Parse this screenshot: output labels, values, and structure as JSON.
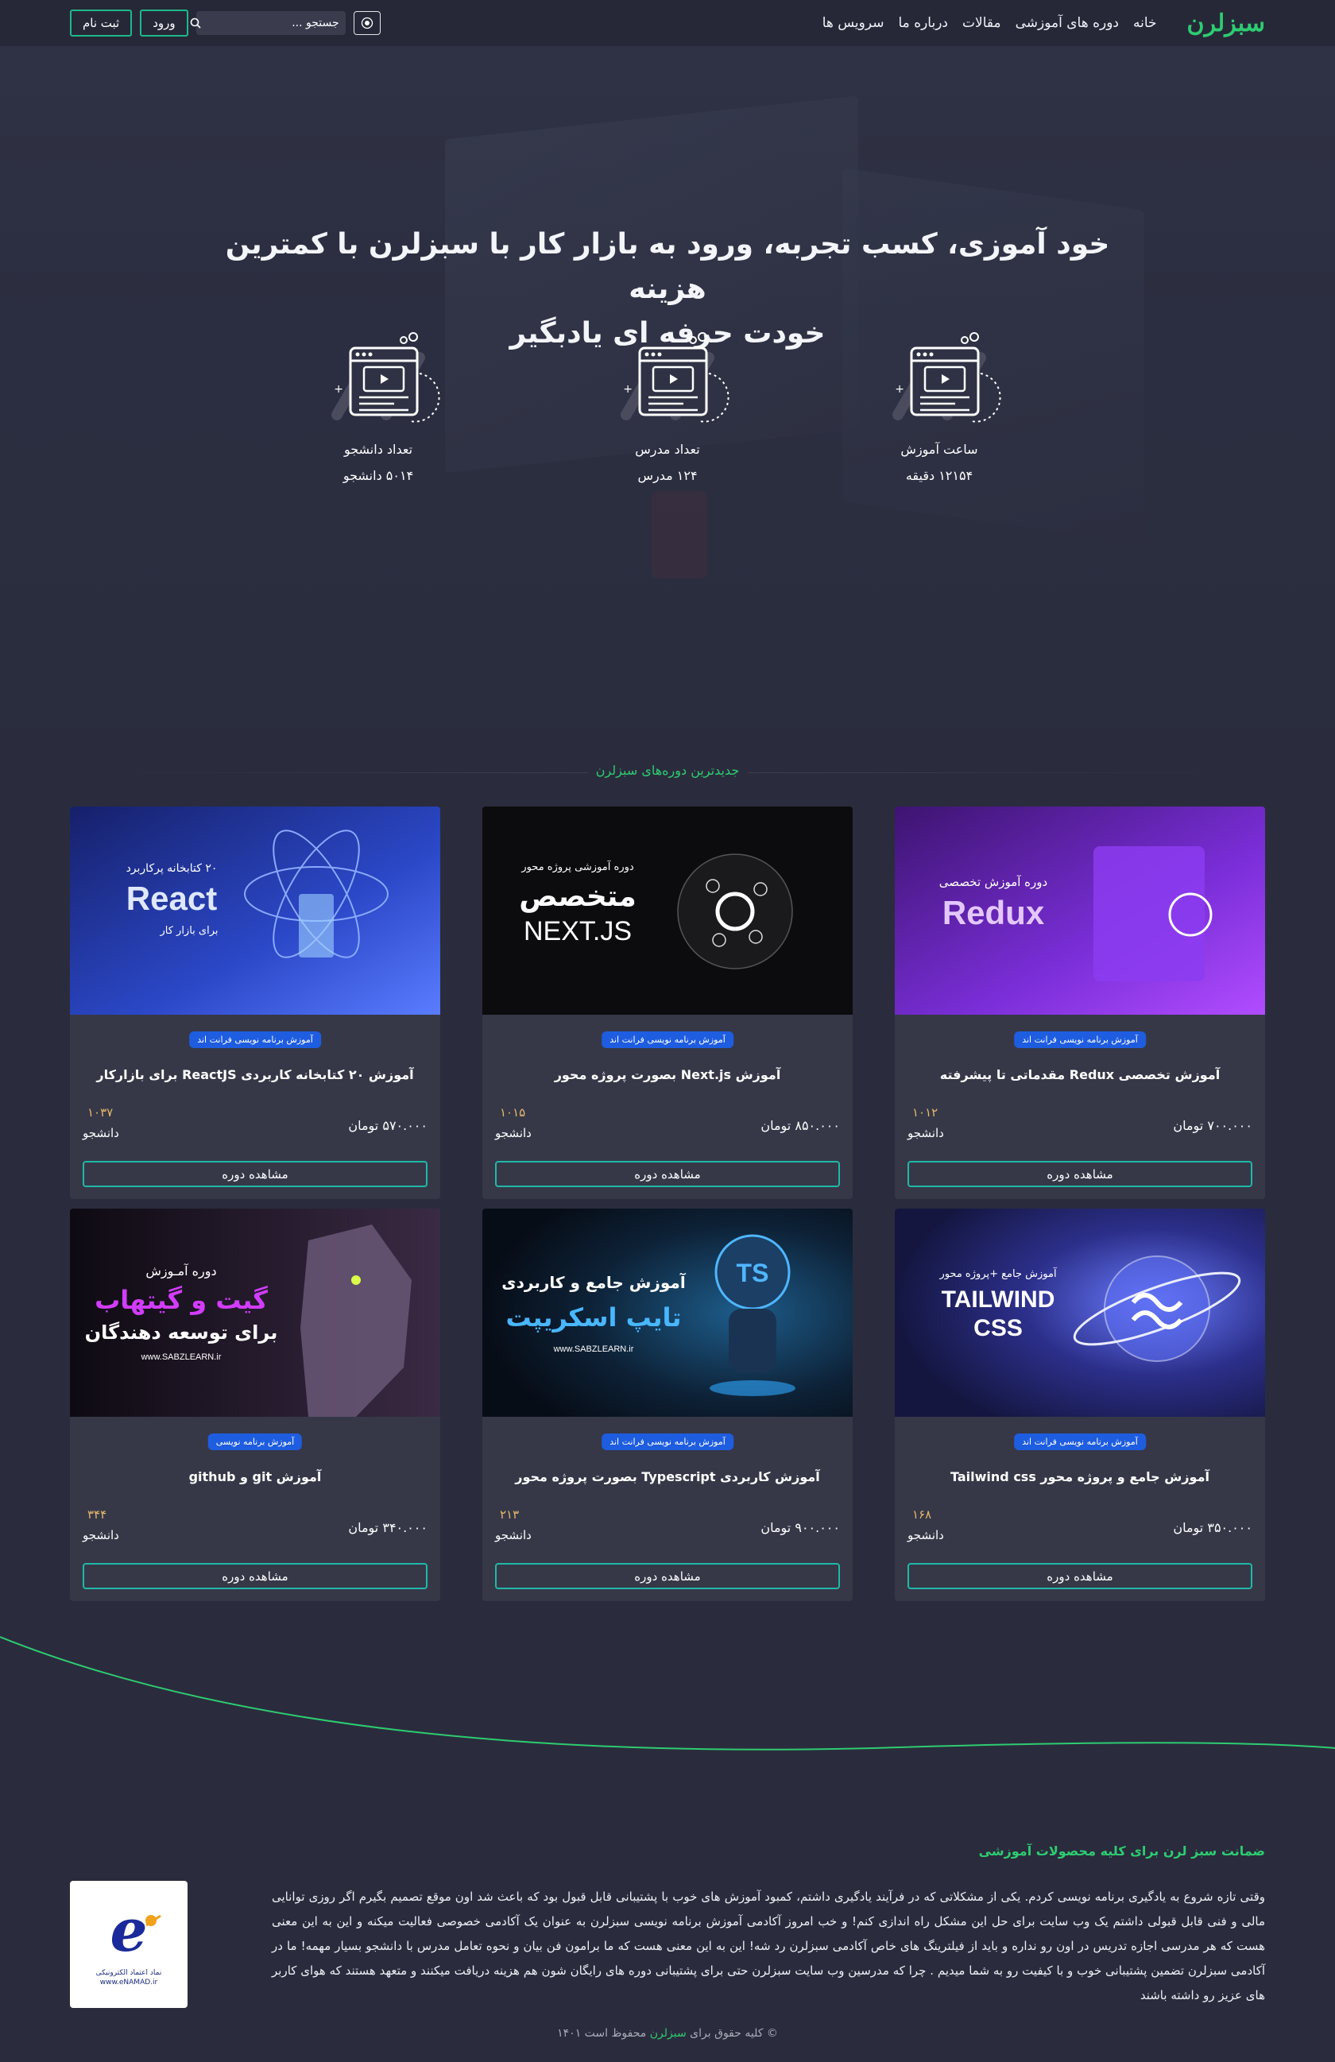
{
  "nav": {
    "logo": "سبزلرن",
    "links": [
      "خانه",
      "دوره های آموزشی",
      "مقالات",
      "درباره ما",
      "سرویس ها"
    ],
    "search_placeholder": "جستجو ...",
    "login_label": "ورود",
    "signup_label": "ثبت نام"
  },
  "hero": {
    "title_line1": "خود آموزی، کسب تجربه، ورود به بازار کار با سبزلرن با کمترین هزینه",
    "title_line2": "خودت حرفه ای یادبگیر",
    "stats": [
      {
        "label": "ساعت آموزش",
        "value": "۱۲۱۵۴ دقیقه"
      },
      {
        "label": "تعداد مدرس",
        "value": "۱۲۴ مدرس"
      },
      {
        "label": "تعداد دانشجو",
        "value": "۵۰۱۴ دانشجو"
      }
    ]
  },
  "latest": {
    "title": "جدیدترین دوره‌های سبزلرن",
    "view_label": "مشاهده دوره",
    "students_label": "دانشجو",
    "courses": [
      {
        "cover_title": "Redux",
        "cover_sub": "دوره آموزش تخصصی",
        "category": "آموزش برنامه نویسی فرانت اند",
        "title": "آموزش تخصصی Redux مقدماتی تا پیشرفته",
        "price": "۷۰۰.۰۰۰ تومان",
        "students": "۱۰۱۲"
      },
      {
        "cover_title": "متخصص",
        "cover_title2": "NEXT.JS",
        "cover_sub": "دوره آموزشی پروژه محور",
        "category": "آموزش برنامه نویسی فرانت اند",
        "title": "آموزش Next.js بصورت پروژه محور",
        "price": "۸۵۰.۰۰۰ تومان",
        "students": "۱۰۱۵"
      },
      {
        "cover_title": "React",
        "cover_sub": "۲۰ کتابخانه پرکاربرد",
        "cover_sub2": "برای بازار کار",
        "category": "آموزش برنامه نویسی فرانت اند",
        "title": "آموزش ۲۰ کتابخانه کاربردی ReactJS برای بازارکار",
        "price": "۵۷۰.۰۰۰ تومان",
        "students": "۱۰۳۷"
      },
      {
        "cover_title": "TAILWIND",
        "cover_title2": "CSS",
        "cover_sub": "آموزش جامع +پروژه محور",
        "category": "آموزش برنامه نویسی فرانت اند",
        "title": "آموزش جامع و پروژه محور Tailwind css",
        "price": "۳۵۰.۰۰۰ تومان",
        "students": "۱۶۸"
      },
      {
        "cover_title": "تایپ اسکریپت",
        "cover_sub": "آموزش جامع و کاربردی",
        "cover_badge": "TS",
        "cover_site": "www.SABZLEARN.ir",
        "category": "آموزش برنامه نویسی فرانت اند",
        "title": "آموزش کاربردی Typescript بصورت پروژه محور",
        "price": "۹۰۰.۰۰۰ تومان",
        "students": "۲۱۳"
      },
      {
        "cover_title": "گیت و گیتهاب",
        "cover_sub": "دوره آمـوزش",
        "cover_sub2": "برای توسعه دهندگان",
        "cover_site": "www.SABZLEARN.ir",
        "category": "آموزش برنامه نویسی",
        "title": "آموزش git و github",
        "price": "۳۴۰.۰۰۰ تومان",
        "students": "۳۴۴"
      }
    ]
  },
  "footer": {
    "title": "ضمانت سبز لرن برای کلیه محصولات آموزشی",
    "text": "وقتی تازه شروع به یادگیری برنامه نویسی کردم. یکی از مشکلاتی که در فرآیند یادگیری داشتم، کمبود آموزش های خوب با پشتیبانی قابل قبول بود که باعث شد اون موقع تصمیم بگیرم اگر روزی توانایی مالی و فنی قابل قبولی داشتم یک وب سایت برای حل این مشکل راه اندازی کنم! و خب امروز آکادمی آموزش برنامه نویسی سبزلرن به عنوان یک آکادمی خصوصی فعالیت میکنه و این به این معنی هست که هر مدرسی اجازه تدریس در اون رو نداره و باید از فیلترینگ های خاص آکادمی سبزلرن رد شه! این به این معنی هست که ما برامون فن بیان و نحوه تعامل مدرس با دانشجو بسیار مهمه! ما در آکادمی سبزلرن تضمین پشتیبانی خوب و با کیفیت رو به شما میدیم . چرا که مدرسین وب سایت سبزلرن حتی برای پشتیبانی دوره های رایگان شون هم هزینه دریافت میکنند و متعهد هستند که هوای کاربر های عزیز رو داشته باشند",
    "enamad_lines": [
      "نماد اعتماد الکترونیکی",
      "www.eNAMAD.ir"
    ],
    "copyright_prefix": "© کلیه حقوق برای",
    "copyright_brand": "سبزلرن",
    "copyright_suffix": "محفوظ است ۱۴۰۱"
  },
  "colors": {
    "accent_green": "#2ecc71",
    "badge_blue": "#1e5de0",
    "page_bg": "#2a2c3d",
    "card_bg": "#363848",
    "price_students_num": "#e6b86a"
  }
}
